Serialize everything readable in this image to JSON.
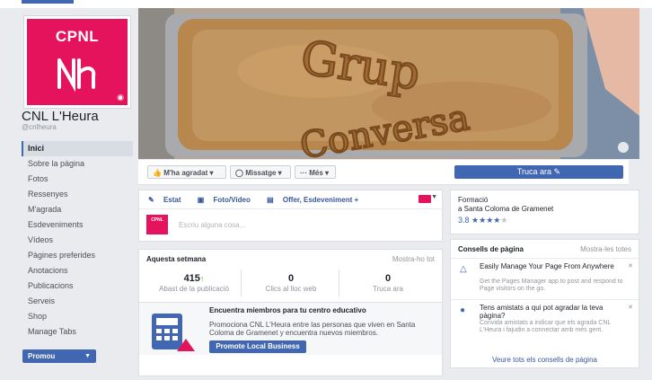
{
  "sidebar": {
    "logo_text": "CPNL",
    "page_name": "CNL L'Heura",
    "handle": "@cnlheura",
    "items": [
      {
        "label": "Inici"
      },
      {
        "label": "Sobre la pàgina"
      },
      {
        "label": "Fotos"
      },
      {
        "label": "Ressenyes"
      },
      {
        "label": "M'agrada"
      },
      {
        "label": "Esdeveniments"
      },
      {
        "label": "Vídeos"
      },
      {
        "label": "Pàgines preferides"
      },
      {
        "label": "Anotacions"
      },
      {
        "label": "Publicacions"
      },
      {
        "label": "Serveis"
      },
      {
        "label": "Shop"
      },
      {
        "label": "Manage Tabs"
      }
    ],
    "promote_label": "Promou"
  },
  "cover": {
    "text_line1": "Grup",
    "text_line2": "Conversa"
  },
  "actions": {
    "like_label": "M'ha agradat ▾",
    "message_label": "Missatge ▾",
    "more_label": "··· Més ▾",
    "call_label": "Truca ara ✎"
  },
  "composer": {
    "tab_status": "Estat",
    "tab_photo": "Foto/Vídeo",
    "tab_offer": "Offer, Esdeveniment +",
    "mini_logo": "CPNL",
    "placeholder": "Escriu alguna cosa..."
  },
  "week": {
    "title": "Aquesta setmana",
    "see_all": "Mostra-ho tot",
    "stats": [
      {
        "value": "415",
        "trend": "↑",
        "label": "Abast de la publicació"
      },
      {
        "value": "0",
        "trend": "",
        "label": "Clics al lloc web"
      },
      {
        "value": "0",
        "trend": "",
        "label": "Truca ara"
      }
    ],
    "promo_title": "Encuentra miembros para tu centro educativo",
    "promo_body": "Promociona CNL L'Heura entre las personas que viven en Santa Coloma de Gramenet y encuentra nuevos miembros.",
    "promo_button": "Promote Local Business"
  },
  "about": {
    "category_line1": "Formació",
    "category_line2": "a Santa Coloma de Gramenet",
    "rating_value": "3.8",
    "rating_stars_filled": 4,
    "rating_stars_total": 5
  },
  "tips": {
    "title": "Consells de pàgina",
    "see_all": "Mostra-les totes",
    "items": [
      {
        "title": "Easily Manage Your Page From Anywhere",
        "body": "Get the Pages Manager app to post and respond to Page visitors on the go."
      },
      {
        "title": "Tens amistats a qui pot agradar la teva pàgina?",
        "body": "Convida amistats a indicar que els agrada CNL L'Heura i fajudin a connectar amb més gent."
      }
    ],
    "all_link": "Veure tots els consells de pàgina"
  },
  "colors": {
    "brand_pink": "#e5125c",
    "fb_blue": "#4267b2"
  }
}
